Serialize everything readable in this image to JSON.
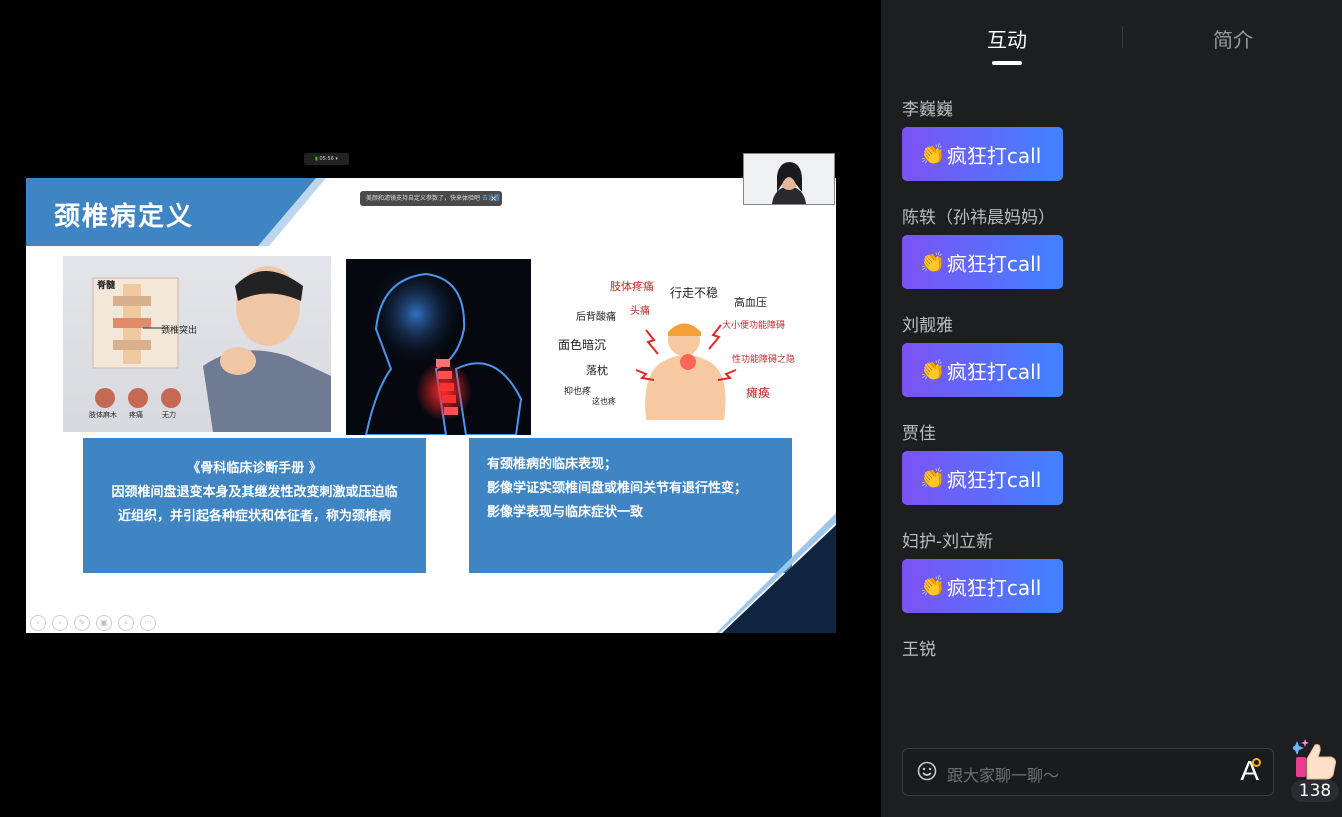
{
  "slide": {
    "title": "颈椎病定义",
    "toast_text": "美颜和滤镜支持自定义参数了，快来体验吧",
    "toast_link": "去设置",
    "toast_close": "×",
    "timer": "05:56",
    "img1_labels": [
      "脊髓",
      "颈椎突出",
      "肢体麻木",
      "疼痛",
      "无力"
    ],
    "img3_symptoms": [
      "肢体疼痛",
      "行走不稳",
      "头痛",
      "高血压",
      "后背酸痛",
      "大小便功能障碍",
      "面色暗沉",
      "落枕",
      "性功能障碍之隐",
      "抑也疼",
      "这也疼",
      "瘫痪"
    ],
    "box1": {
      "line1": "《骨科临床诊断手册 》",
      "line2": "因颈椎间盘退变本身及其继发性改变刺激或压迫临",
      "line3": "近组织，并引起各种症状和体征者，称为颈椎病"
    },
    "box2": {
      "line1": "有颈椎病的临床表现；",
      "line2": "影像学证实颈椎间盘或椎间关节有退行性变；",
      "line3": "影像学表现与临床症状一致"
    },
    "controls": [
      "‹",
      "›",
      "✎",
      "▣",
      "⌕",
      "···"
    ]
  },
  "panel": {
    "tabs": [
      {
        "label": "互动",
        "active": true
      },
      {
        "label": "简介",
        "active": false
      }
    ],
    "messages": [
      {
        "name": "李巍巍",
        "content": "疯狂打call"
      },
      {
        "name": "陈轶（孙祎晨妈妈）",
        "content": "疯狂打call"
      },
      {
        "name": "刘靓雅",
        "content": "疯狂打call"
      },
      {
        "name": "贾佳",
        "content": "疯狂打call"
      },
      {
        "name": "妇护-刘立新",
        "content": "疯狂打call"
      },
      {
        "name": "王锐",
        "content": ""
      }
    ],
    "chat_placeholder": "跟大家聊一聊～",
    "like_count": "138"
  },
  "colors": {
    "slide_blue": "#3f85c4",
    "panel_bg": "#1d1e22",
    "pill_start": "#7d52f5",
    "pill_end": "#3f83ff"
  }
}
